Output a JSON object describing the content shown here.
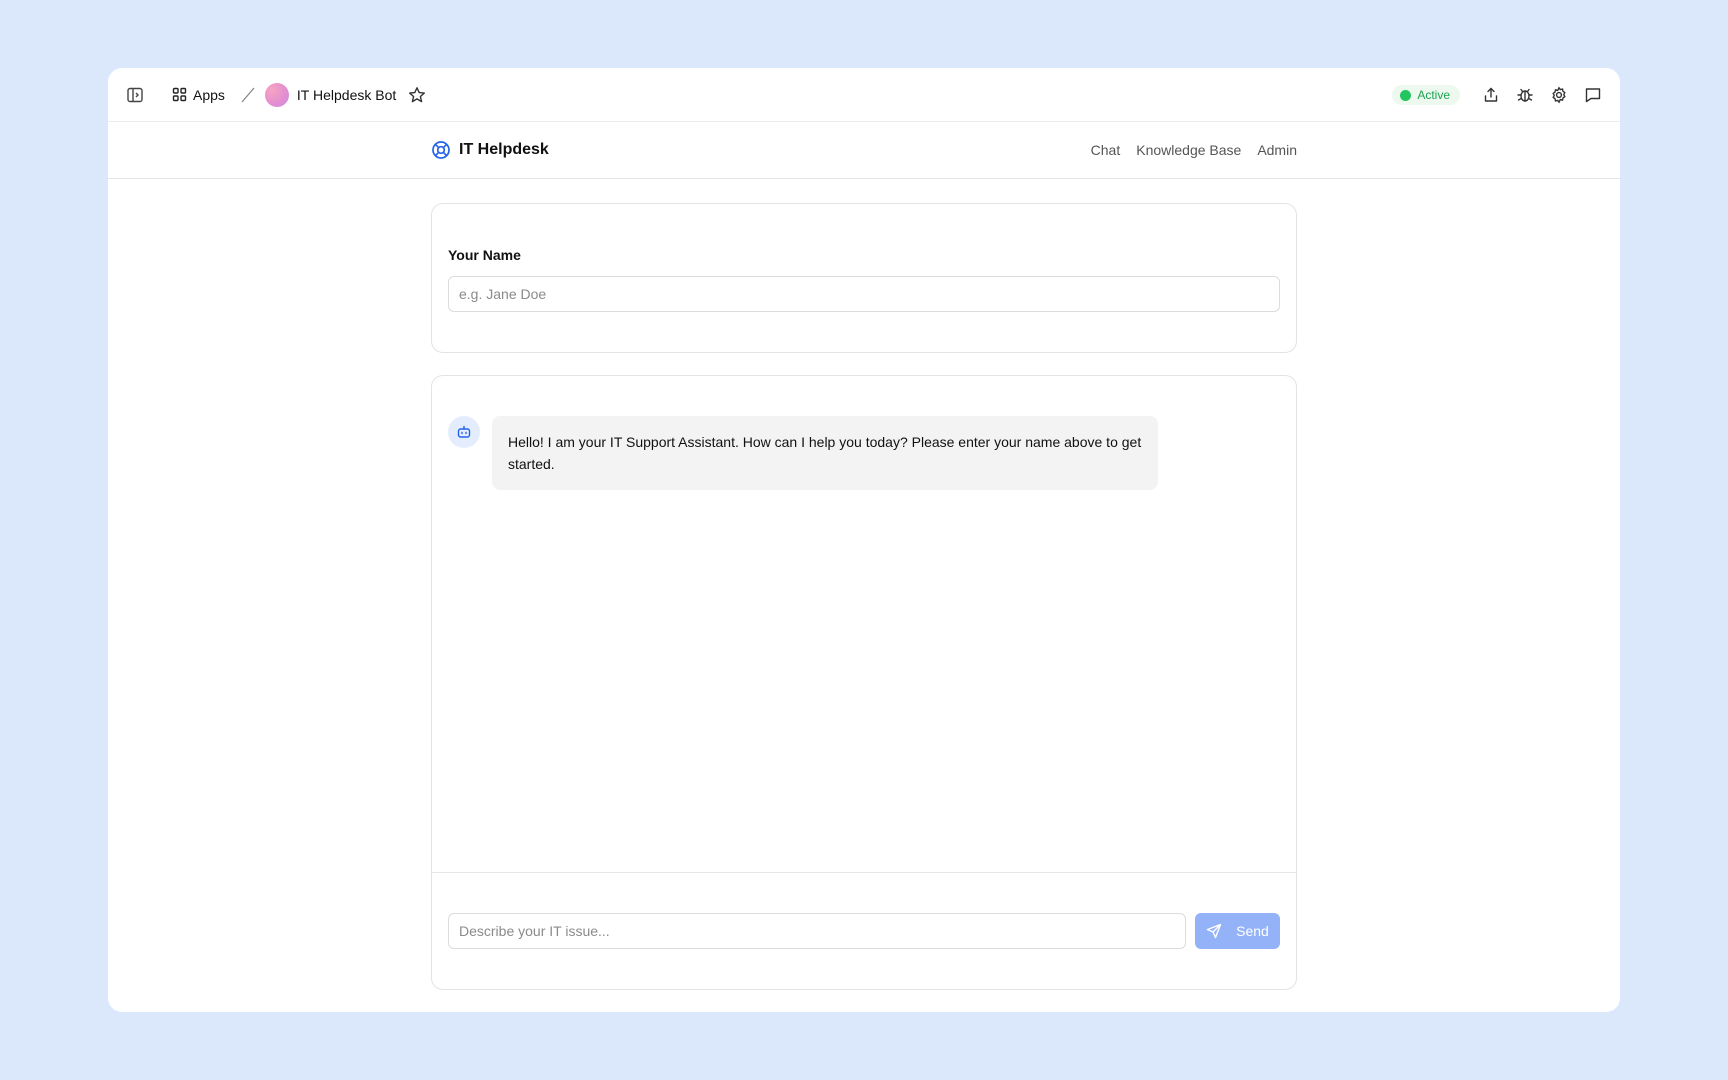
{
  "topbar": {
    "apps_label": "Apps",
    "app_name": "IT Helpdesk Bot",
    "status": "Active",
    "status_color": "#22c55e",
    "icons": [
      "sidebar-toggle-icon",
      "grid-icon",
      "star-icon",
      "share-icon",
      "bug-icon",
      "gear-icon",
      "chat-bubble-icon"
    ]
  },
  "header": {
    "brand": "IT Helpdesk",
    "nav": [
      "Chat",
      "Knowledge Base",
      "Admin"
    ]
  },
  "name_card": {
    "label": "Your Name",
    "placeholder": "e.g. Jane Doe",
    "value": ""
  },
  "chat": {
    "messages": [
      {
        "sender": "bot",
        "text": "Hello! I am your IT Support Assistant. How can I help you today? Please enter your name above to get started."
      }
    ],
    "input_placeholder": "Describe your IT issue...",
    "input_value": "",
    "send_label": "Send"
  },
  "colors": {
    "accent": "#2563eb",
    "send_button": "#94b2f7",
    "page_background": "#dbe8fc"
  }
}
